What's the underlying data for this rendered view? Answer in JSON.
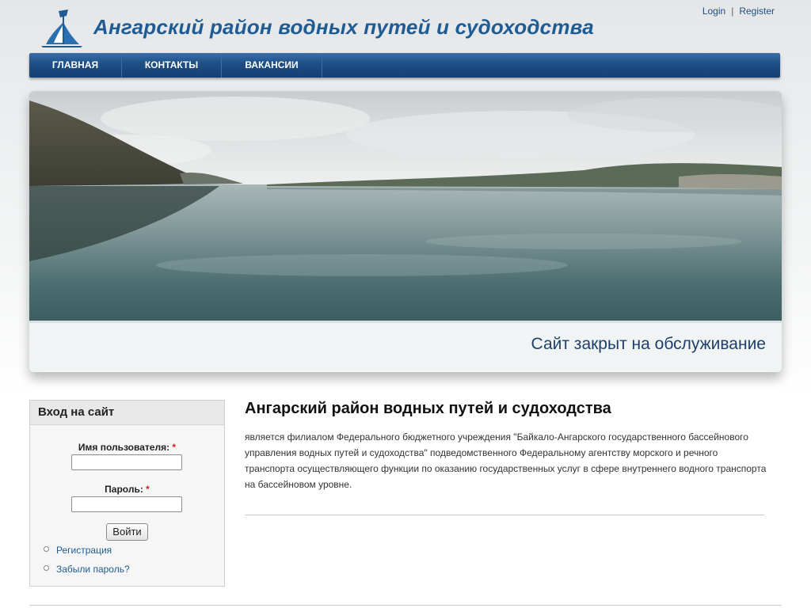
{
  "header": {
    "site_title": "Ангарский район водных путей и судоходства",
    "logo_icon": "sail-logo-icon"
  },
  "user_links": {
    "login": "Login",
    "separator": "|",
    "register": "Register"
  },
  "nav": {
    "items": [
      {
        "label": "ГЛАВНАЯ"
      },
      {
        "label": "КОНТАКТЫ"
      },
      {
        "label": "ВАКАНСИИ"
      }
    ]
  },
  "banner": {
    "caption": "Сайт закрыт на обслуживание"
  },
  "login_block": {
    "title": "Вход на сайт",
    "username_label": "Имя пользователя:",
    "username_value": "",
    "password_label": "Пароль:",
    "password_value": "",
    "required_mark": "*",
    "submit_label": "Войти",
    "links": [
      {
        "label": "Регистрация"
      },
      {
        "label": "Забыли пароль?"
      }
    ]
  },
  "main": {
    "title": "Ангарский район водных путей и судоходства",
    "text": "является филиалом Федерального бюджетного учреждения \"Байкало-Ангарского государственного бассейнового управления водных путей и судоходства\" подведомственного Федеральному агентству морского и речного транспорта осуществляющего функции по оказанию государственных услуг в сфере внутреннего водного транспорта на бассейновом уровне."
  },
  "colors": {
    "brand_blue": "#1f5c94",
    "nav_blue": "#1d4e85",
    "caption_text": "#1f3f6a",
    "required": "#cc2222"
  }
}
